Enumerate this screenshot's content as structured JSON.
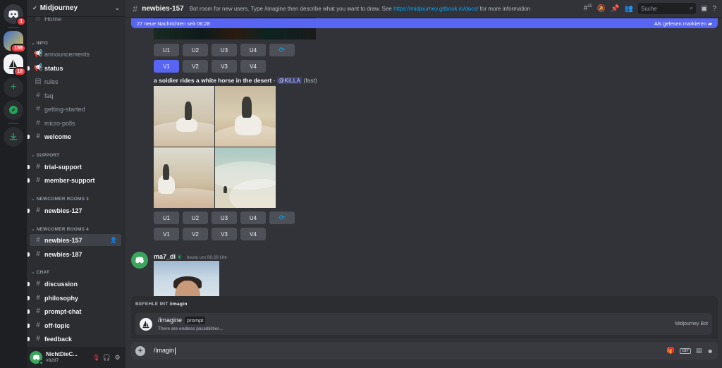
{
  "rail": {
    "servers": [
      {
        "id": "home",
        "badge": "1"
      },
      {
        "id": "server-2",
        "badge": "159"
      },
      {
        "id": "midjourney",
        "badge": "10"
      }
    ]
  },
  "server": {
    "name": "Midjourney"
  },
  "sidebar": {
    "home_label": "Home",
    "categories": {
      "info": "INFO",
      "support": "SUPPORT",
      "newcomer3": "NEWCOMER ROOMS 3",
      "newcomer4": "NEWCOMER ROOMS 4",
      "chat": "CHAT"
    },
    "channels": {
      "announcements": "announcements",
      "status": "status",
      "rules": "rules",
      "faq": "faq",
      "getting_started": "getting-started",
      "micro_polls": "micro-polls",
      "welcome": "welcome",
      "trial_support": "trial-support",
      "member_support": "member-support",
      "newbies_127": "newbies-127",
      "newbies_157": "newbies-157",
      "newbies_187": "newbies-187",
      "discussion": "discussion",
      "philosophy": "philosophy",
      "prompt_chat": "prompt-chat",
      "off_topic": "off-topic",
      "feedback": "feedback"
    }
  },
  "user": {
    "name": "NichtDieC...",
    "tag": "#8287"
  },
  "topbar": {
    "channel": "newbies-157",
    "topic_prefix": "Bot room for new users. Type /imagine then describe what you want to draw. See",
    "topic_link": "https://midjourney.gitbook.io/docs/",
    "topic_suffix": "for more information",
    "thread_count": "11",
    "search_placeholder": "Suche"
  },
  "new_messages_bar": {
    "text": "27 neue Nachrichten seit 06:28",
    "action": "Als gelesen markieren"
  },
  "job1": {
    "upscale": [
      "U1",
      "U2",
      "U3",
      "U4"
    ],
    "variation": [
      "V1",
      "V2",
      "V3",
      "V4"
    ]
  },
  "job2": {
    "prompt": "a soldier rides a white horse in the desert",
    "separator": " - ",
    "mention": "@KiLLA",
    "speed": "(fast)",
    "upscale": [
      "U1",
      "U2",
      "U3",
      "U4"
    ],
    "variation": [
      "V1",
      "V2",
      "V3",
      "V4"
    ]
  },
  "message2": {
    "author": "ma7_di",
    "timestamp": "heute um 06:28 Uhr"
  },
  "command_popup": {
    "header_prefix": "BEFEHLE MIT",
    "header_query": "/imagin",
    "command": "/imagine",
    "argument": "prompt",
    "description": "There are endless possibilities...",
    "source": "Midjourney Bot"
  },
  "input": {
    "value": "/imagin"
  }
}
